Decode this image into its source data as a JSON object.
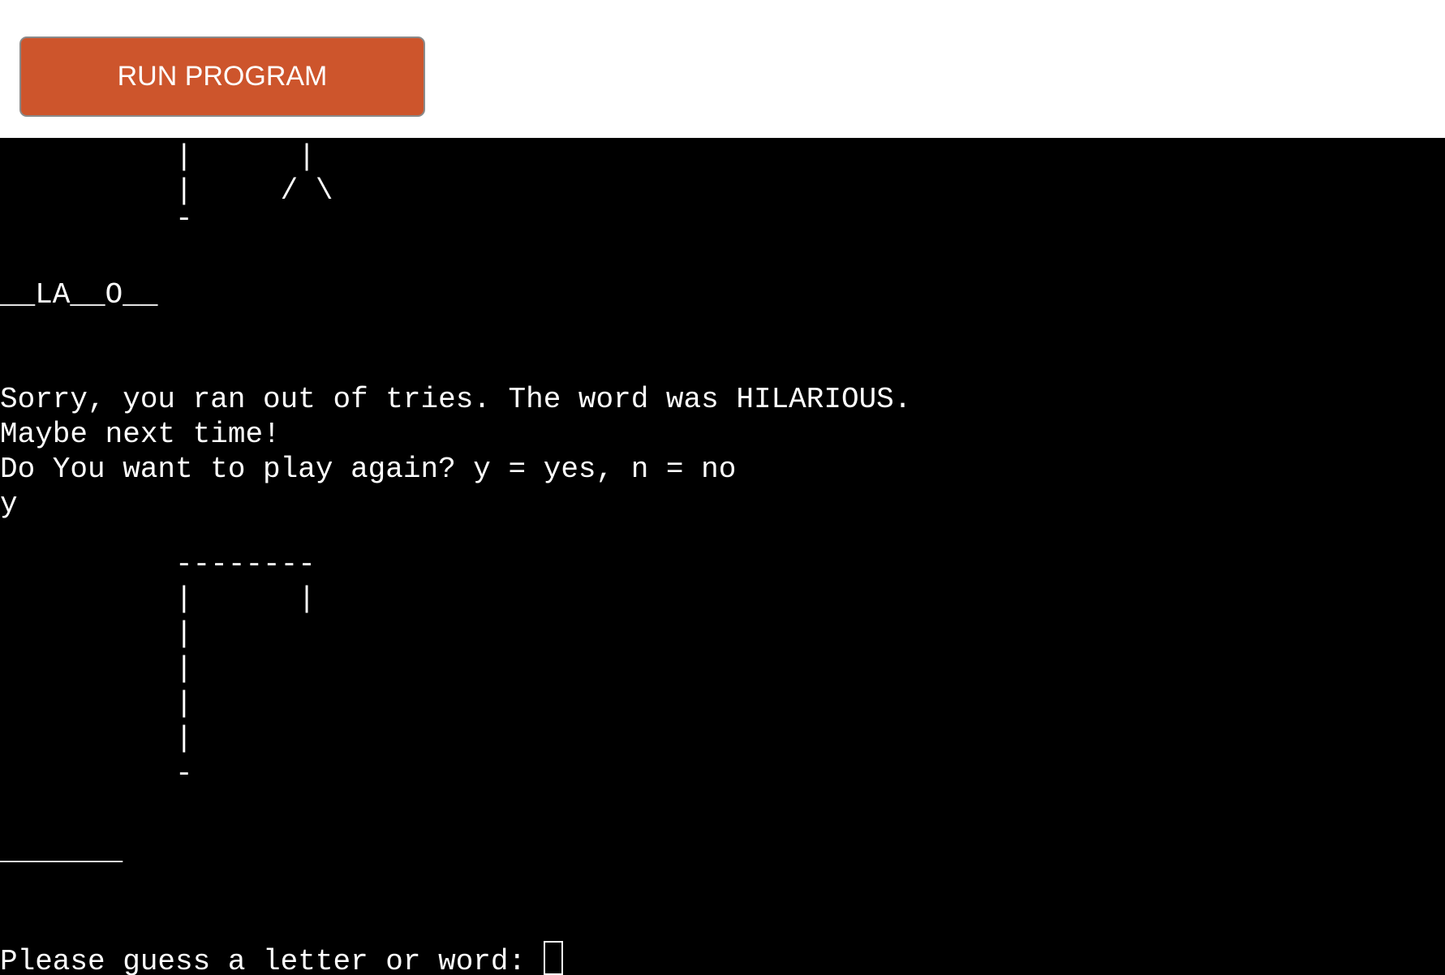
{
  "toolbar": {
    "run_label": "RUN PROGRAM"
  },
  "terminal": {
    "lines": [
      "          |      |",
      "          |     / \\",
      "          -",
      "",
      "__LA__O__",
      "",
      "",
      "Sorry, you ran out of tries. The word was HILARIOUS.",
      "Maybe next time!",
      "Do You want to play again? y = yes, n = no",
      "y",
      "",
      "          --------",
      "          |      |",
      "          |",
      "          |",
      "          |",
      "          |",
      "          -",
      "",
      "_______",
      "",
      "",
      "Please guess a letter or word: "
    ]
  },
  "colors": {
    "button_bg": "#cd552c",
    "terminal_bg": "#000000",
    "terminal_fg": "#ffffff"
  }
}
